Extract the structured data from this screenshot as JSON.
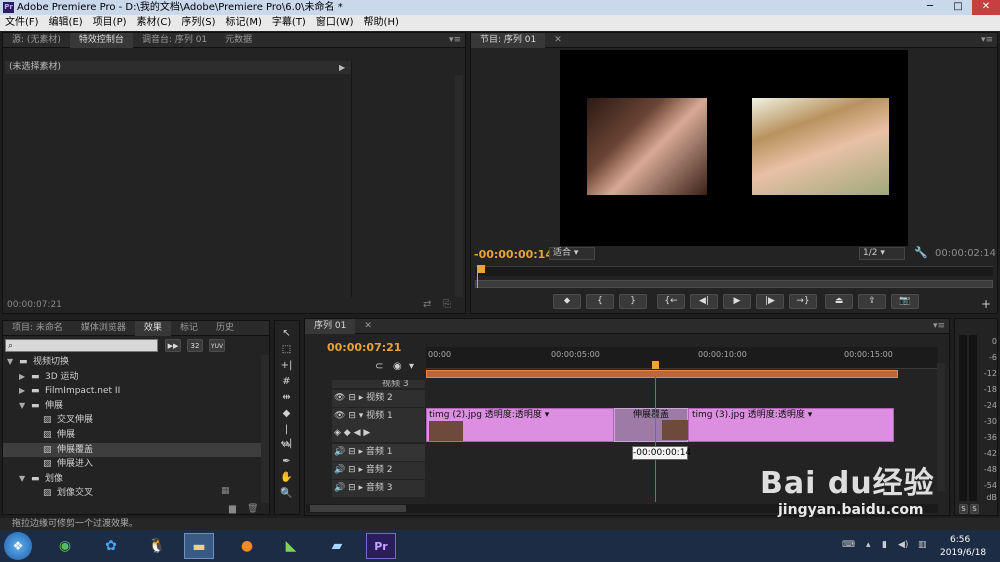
{
  "window": {
    "title": "Adobe Premiere Pro - D:\\我的文档\\Adobe\\Premiere Pro\\6.0\\未命名 *",
    "app_icon": "Pr"
  },
  "menu": [
    "文件(F)",
    "编辑(E)",
    "项目(P)",
    "素材(C)",
    "序列(S)",
    "标记(M)",
    "字幕(T)",
    "窗口(W)",
    "帮助(H)"
  ],
  "source_panel": {
    "tabs": [
      "源: (无素材)",
      "特效控制台",
      "调音台: 序列 01",
      "元数据"
    ],
    "active_tab": 1,
    "no_clip_label": "(未选择素材)",
    "timecode": "00:00:07:21"
  },
  "program_panel": {
    "tab": "节目: 序列 01",
    "current_time": "-00:00:00:14",
    "fit": "适合",
    "quality": "1/2",
    "duration": "00:00:02:14",
    "controls": [
      "mark-in-icon",
      "mark-out-icon",
      "goto-in-icon",
      "step-back-icon",
      "play-icon",
      "step-forward-icon",
      "goto-out-icon",
      "lift-icon",
      "extract-icon",
      "export-frame-icon"
    ]
  },
  "project_panel": {
    "tabs": [
      "项目: 未命名",
      "媒体浏览器",
      "效果",
      "标记",
      "历史"
    ],
    "active_tab": 2,
    "preset_badges": [
      "32",
      "YUV"
    ],
    "tree": [
      {
        "label": "视频切换",
        "depth": 0,
        "type": "folder",
        "open": true
      },
      {
        "label": "3D 运动",
        "depth": 1,
        "type": "folder",
        "open": false
      },
      {
        "label": "FilmImpact.net II",
        "depth": 1,
        "type": "folder",
        "open": false
      },
      {
        "label": "伸展",
        "depth": 1,
        "type": "folder",
        "open": true
      },
      {
        "label": "交叉伸展",
        "depth": 2,
        "type": "effect"
      },
      {
        "label": "伸展",
        "depth": 2,
        "type": "effect"
      },
      {
        "label": "伸展覆盖",
        "depth": 2,
        "type": "effect",
        "selected": true
      },
      {
        "label": "伸展进入",
        "depth": 2,
        "type": "effect"
      },
      {
        "label": "划像",
        "depth": 1,
        "type": "folder",
        "open": true
      },
      {
        "label": "划像交叉",
        "depth": 2,
        "type": "effect"
      }
    ]
  },
  "timeline": {
    "tab": "序列 01",
    "current_time": "00:00:07:21",
    "ruler": [
      "00:00",
      "00:00:05:00",
      "00:00:10:00",
      "00:00:15:00"
    ],
    "tracks": [
      {
        "name": "视频 3",
        "kind": "video"
      },
      {
        "name": "视频 2",
        "kind": "video"
      },
      {
        "name": "视频 1",
        "kind": "video"
      },
      {
        "name": "音频 1",
        "kind": "audio"
      },
      {
        "name": "音频 2",
        "kind": "audio"
      },
      {
        "name": "音频 3",
        "kind": "audio"
      }
    ],
    "clips": [
      {
        "name": "timg (2).jpg",
        "effect": "透明度:透明度"
      },
      {
        "name": "timg (3).jpg",
        "effect": "透明度:透明度"
      }
    ],
    "transition": "伸展覆盖",
    "tooltip": "-00:00:00:14"
  },
  "audio_meter": {
    "scale": [
      "0",
      "-6",
      "-12",
      "-18",
      "-24",
      "-30",
      "-36",
      "-42",
      "-48",
      "-54",
      "dB"
    ],
    "solo": [
      "S",
      "S"
    ]
  },
  "status_bar": "拖拉边缘可修剪一个过渡效果。",
  "taskbar": {
    "time": "6:56",
    "date": "2019/6/18"
  },
  "watermark": {
    "brand": "Bai du经验",
    "url": "jingyan.baidu.com"
  }
}
